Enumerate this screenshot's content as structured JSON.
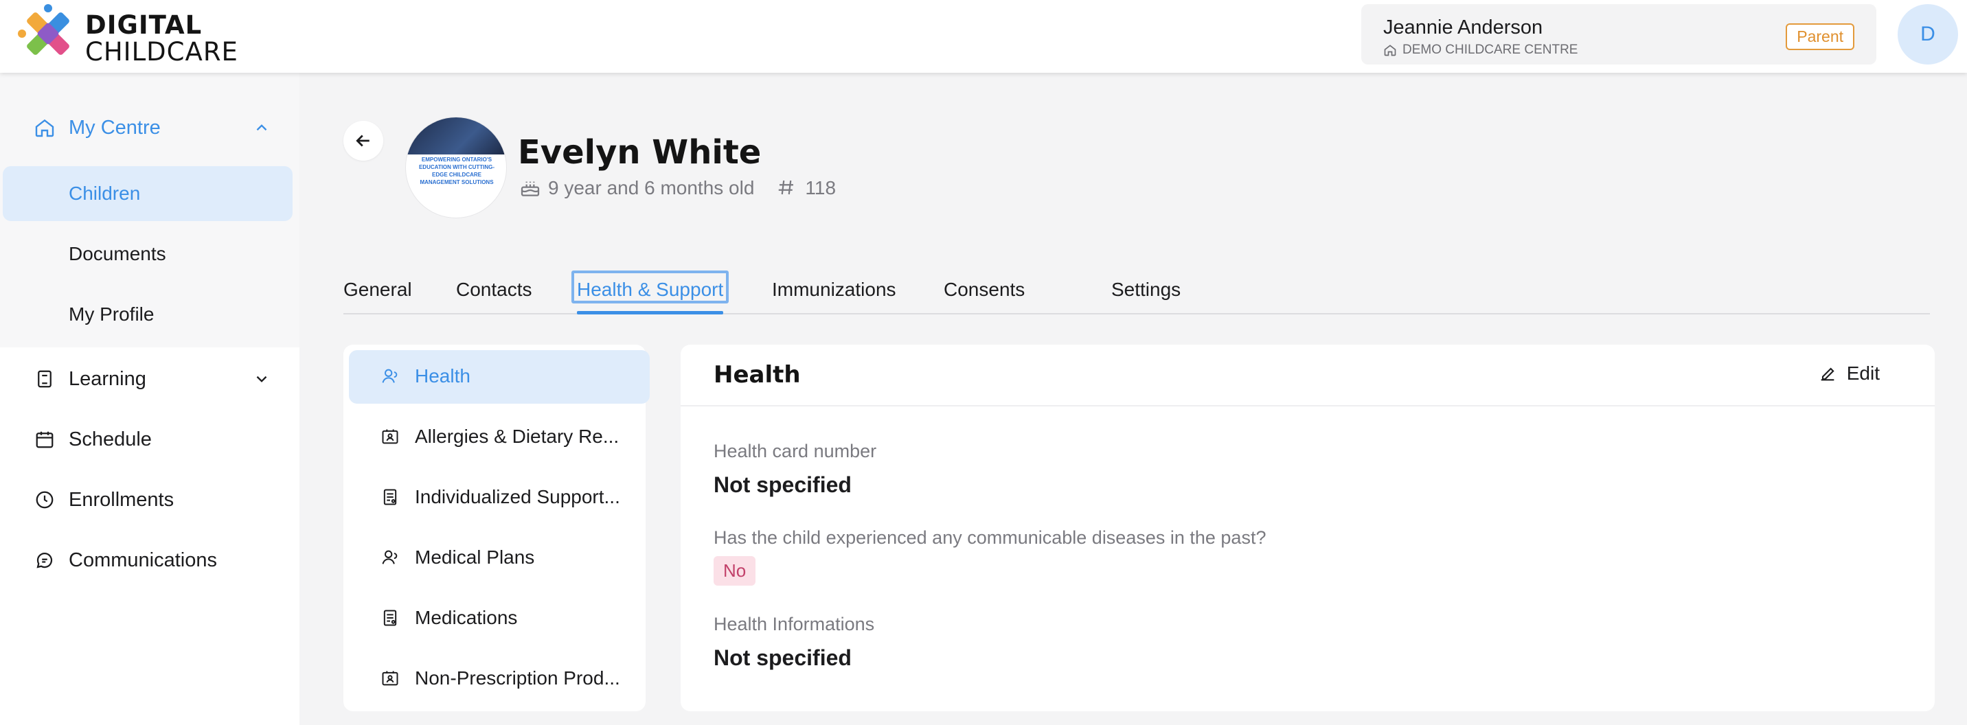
{
  "brand": {
    "line1": "DIGITAL",
    "line2": "CHILDCARE"
  },
  "user": {
    "name": "Jeannie Anderson",
    "centre": "DEMO CHILDCARE CENTRE",
    "role": "Parent",
    "avatar_initial": "D"
  },
  "sidebar": {
    "items": [
      {
        "label": "My Centre",
        "icon": "home-icon",
        "expanded": true
      },
      {
        "label": "Learning",
        "icon": "book-icon",
        "expanded": false
      },
      {
        "label": "Schedule",
        "icon": "calendar-icon"
      },
      {
        "label": "Enrollments",
        "icon": "enrollment-icon"
      },
      {
        "label": "Communications",
        "icon": "chat-icon"
      }
    ],
    "subitems": [
      {
        "label": "Children",
        "selected": true
      },
      {
        "label": "Documents"
      },
      {
        "label": "My Profile"
      }
    ]
  },
  "child": {
    "name": "Evelyn White",
    "age": "9 year and 6 months old",
    "id": "118",
    "photo_text": "EMPOWERING ONTARIO'S EDUCATION WITH CUTTING-EDGE CHILDCARE MANAGEMENT SOLUTIONS"
  },
  "tabs": [
    "General",
    "Contacts",
    "Health & Support",
    "Immunizations",
    "Consents",
    "Settings"
  ],
  "active_tab": "Health & Support",
  "subnav": [
    {
      "label": "Health",
      "icon": "person-icon"
    },
    {
      "label": "Allergies & Dietary Re...",
      "icon": "id-card-icon"
    },
    {
      "label": "Individualized Support...",
      "icon": "document-icon"
    },
    {
      "label": "Medical Plans",
      "icon": "person-icon"
    },
    {
      "label": "Medications",
      "icon": "document-icon"
    },
    {
      "label": "Non-Prescription Prod...",
      "icon": "id-card-icon"
    }
  ],
  "card": {
    "title": "Health",
    "edit_label": "Edit",
    "fields": [
      {
        "label": "Health card number",
        "value": "Not specified"
      },
      {
        "label": "Has the child experienced any communicable diseases in the past?",
        "value": "No"
      },
      {
        "label": "Health Informations",
        "value": "Not specified"
      }
    ]
  },
  "colors": {
    "accent": "#3b8fe6",
    "selected_bg": "#dfecfb",
    "role_badge": "#e0902e",
    "pill_no_bg": "#fbe0e7",
    "pill_no_text": "#c2416a"
  }
}
